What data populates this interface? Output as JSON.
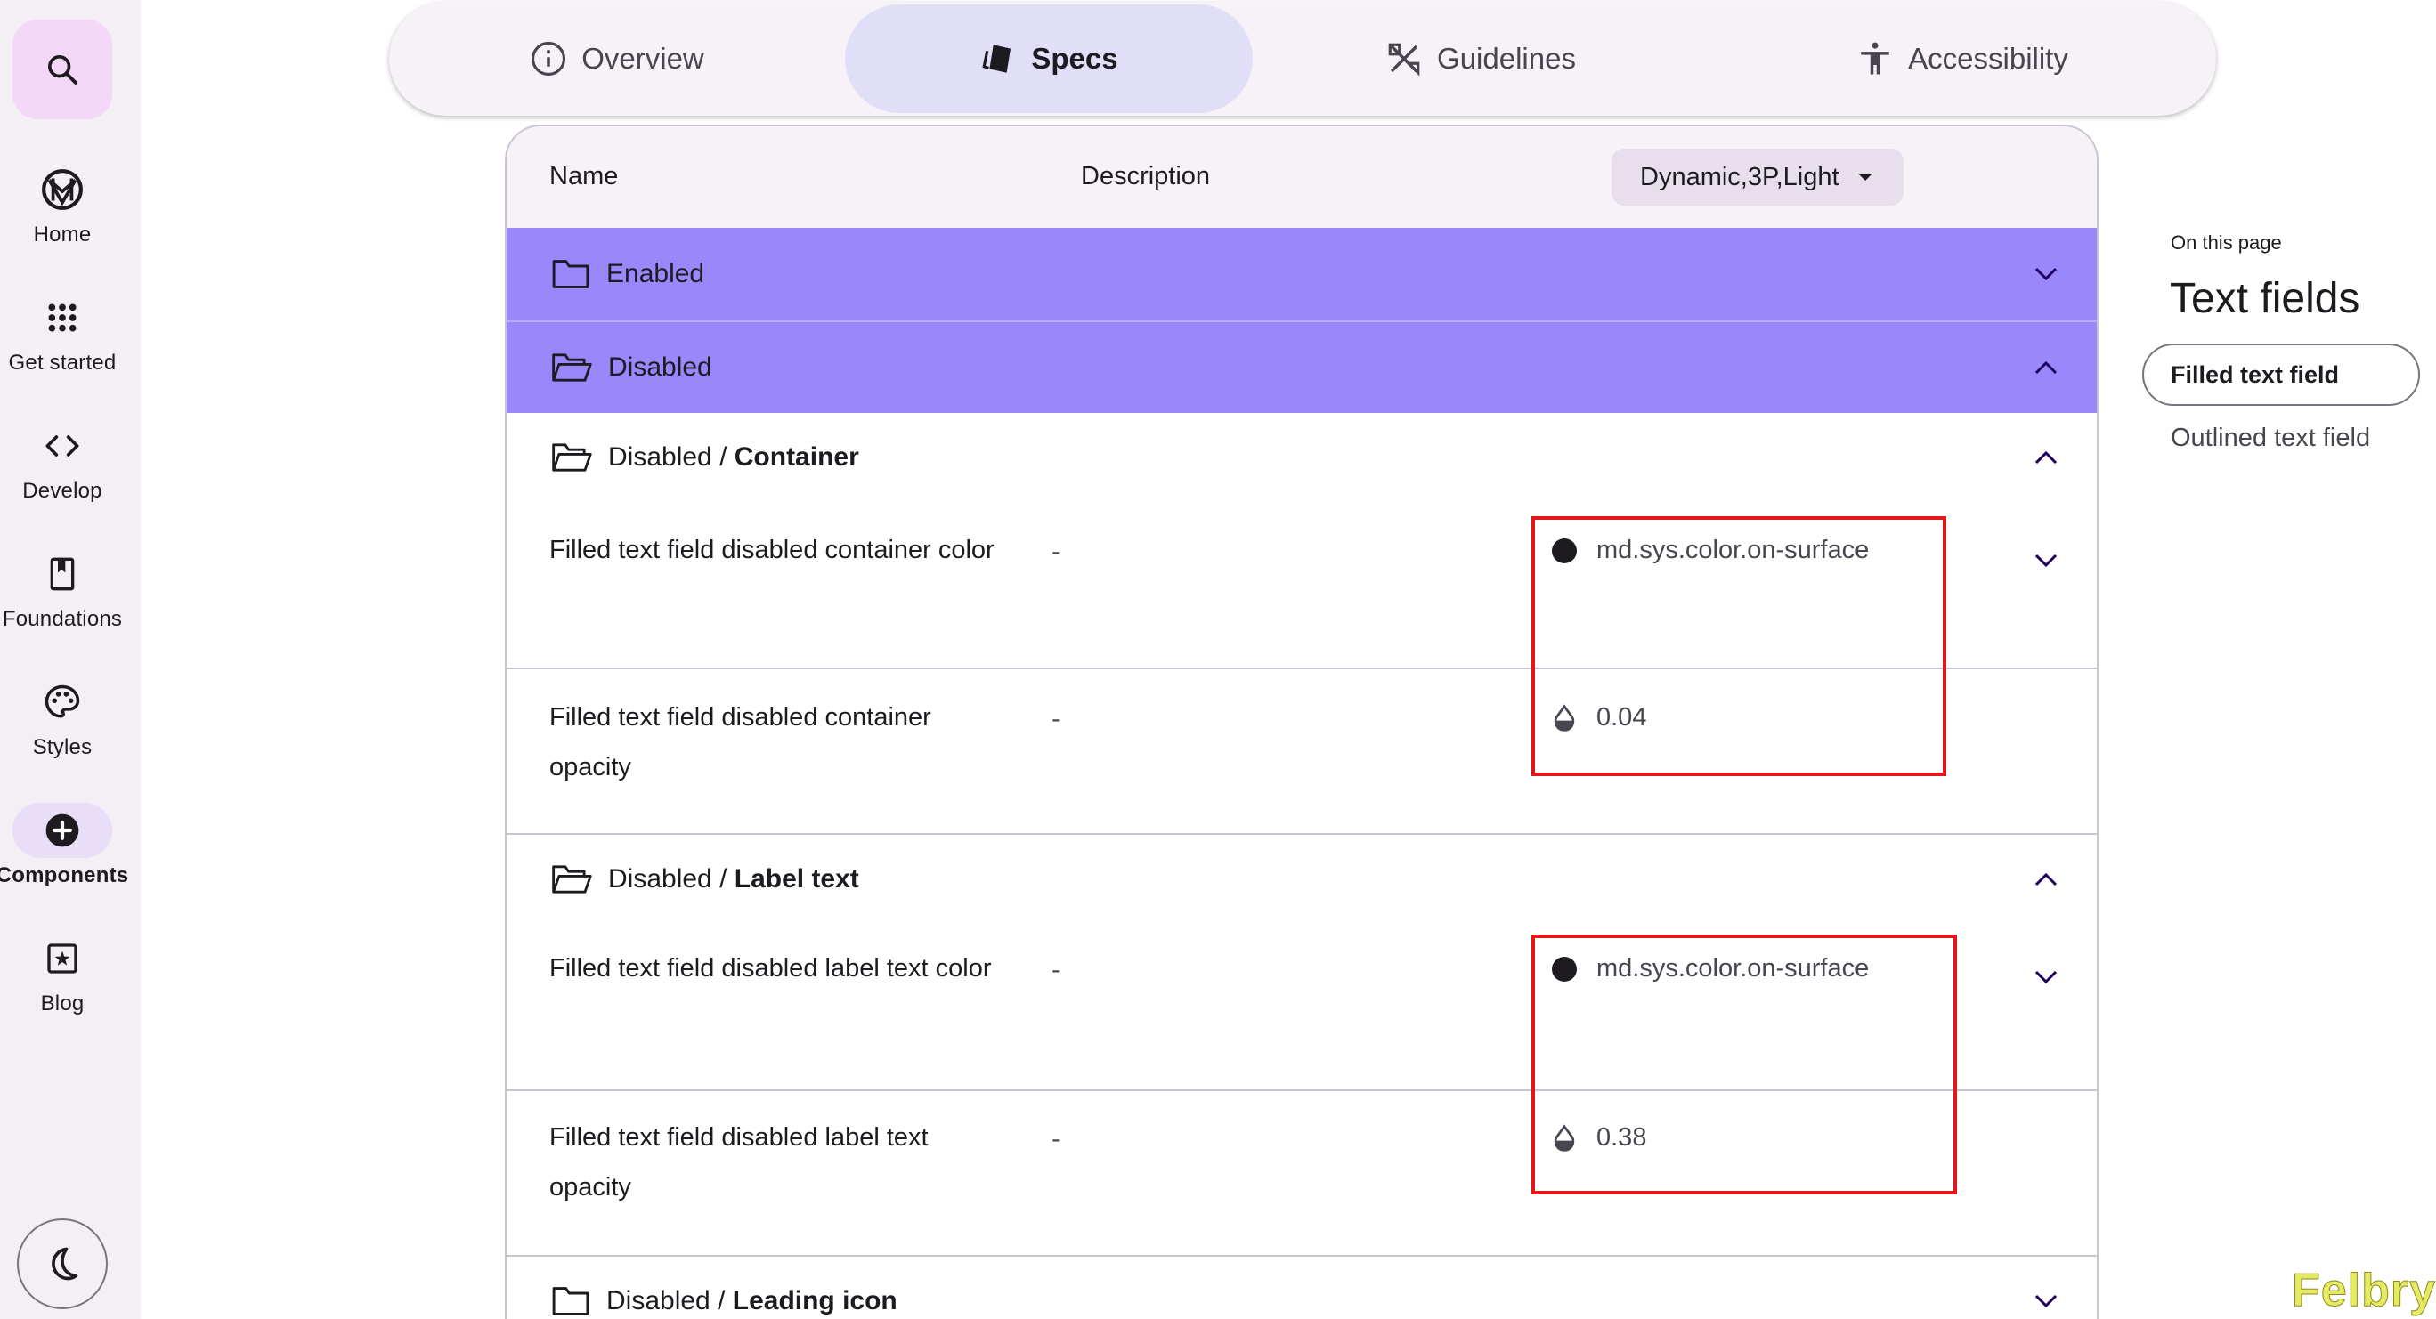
{
  "rail": {
    "items": [
      {
        "label": "Home",
        "icon": "material-logo-icon",
        "active": false
      },
      {
        "label": "Get started",
        "icon": "apps-grid-icon",
        "active": false
      },
      {
        "label": "Develop",
        "icon": "code-icon",
        "active": false
      },
      {
        "label": "Foundations",
        "icon": "bookmark-book-icon",
        "active": false
      },
      {
        "label": "Styles",
        "icon": "palette-icon",
        "active": false
      },
      {
        "label": "Components",
        "icon": "add-circle-icon",
        "active": true
      },
      {
        "label": "Blog",
        "icon": "star-square-icon",
        "active": false
      }
    ]
  },
  "tabs": [
    {
      "label": "Overview",
      "icon": "info-icon"
    },
    {
      "label": "Specs",
      "icon": "specs-icon",
      "active": true
    },
    {
      "label": "Guidelines",
      "icon": "guidelines-icon"
    },
    {
      "label": "Accessibility",
      "icon": "accessibility-icon"
    }
  ],
  "table": {
    "header": {
      "name": "Name",
      "description": "Description",
      "theme": "Dynamic,3P,Light"
    },
    "groups": {
      "enabled": "Enabled",
      "disabled": "Disabled"
    },
    "subgroups": [
      {
        "prefix": "Disabled / ",
        "bold": "Container"
      },
      {
        "prefix": "Disabled / ",
        "bold": "Label text"
      },
      {
        "prefix": "Disabled / ",
        "bold": "Leading icon"
      }
    ],
    "tokens": [
      {
        "name": "Filled text field disabled container color",
        "description": "-",
        "value": "md.sys.color.on-surface",
        "kind": "color"
      },
      {
        "name": "Filled text field disabled container opacity",
        "description": "-",
        "value": "0.04",
        "kind": "opacity"
      },
      {
        "name": "Filled text field disabled label text color",
        "description": "-",
        "value": "md.sys.color.on-surface",
        "kind": "color"
      },
      {
        "name": "Filled text field disabled label text opacity",
        "description": "-",
        "value": "0.38",
        "kind": "opacity"
      }
    ]
  },
  "on_this_page": {
    "label": "On this page",
    "title": "Text fields",
    "items": [
      "Filled text field",
      "Outlined text field"
    ]
  },
  "watermark": "Felbry",
  "colors": {
    "group_row": "#9b87fc",
    "active_tab": "#e1def8",
    "highlight": "#e3161a"
  }
}
